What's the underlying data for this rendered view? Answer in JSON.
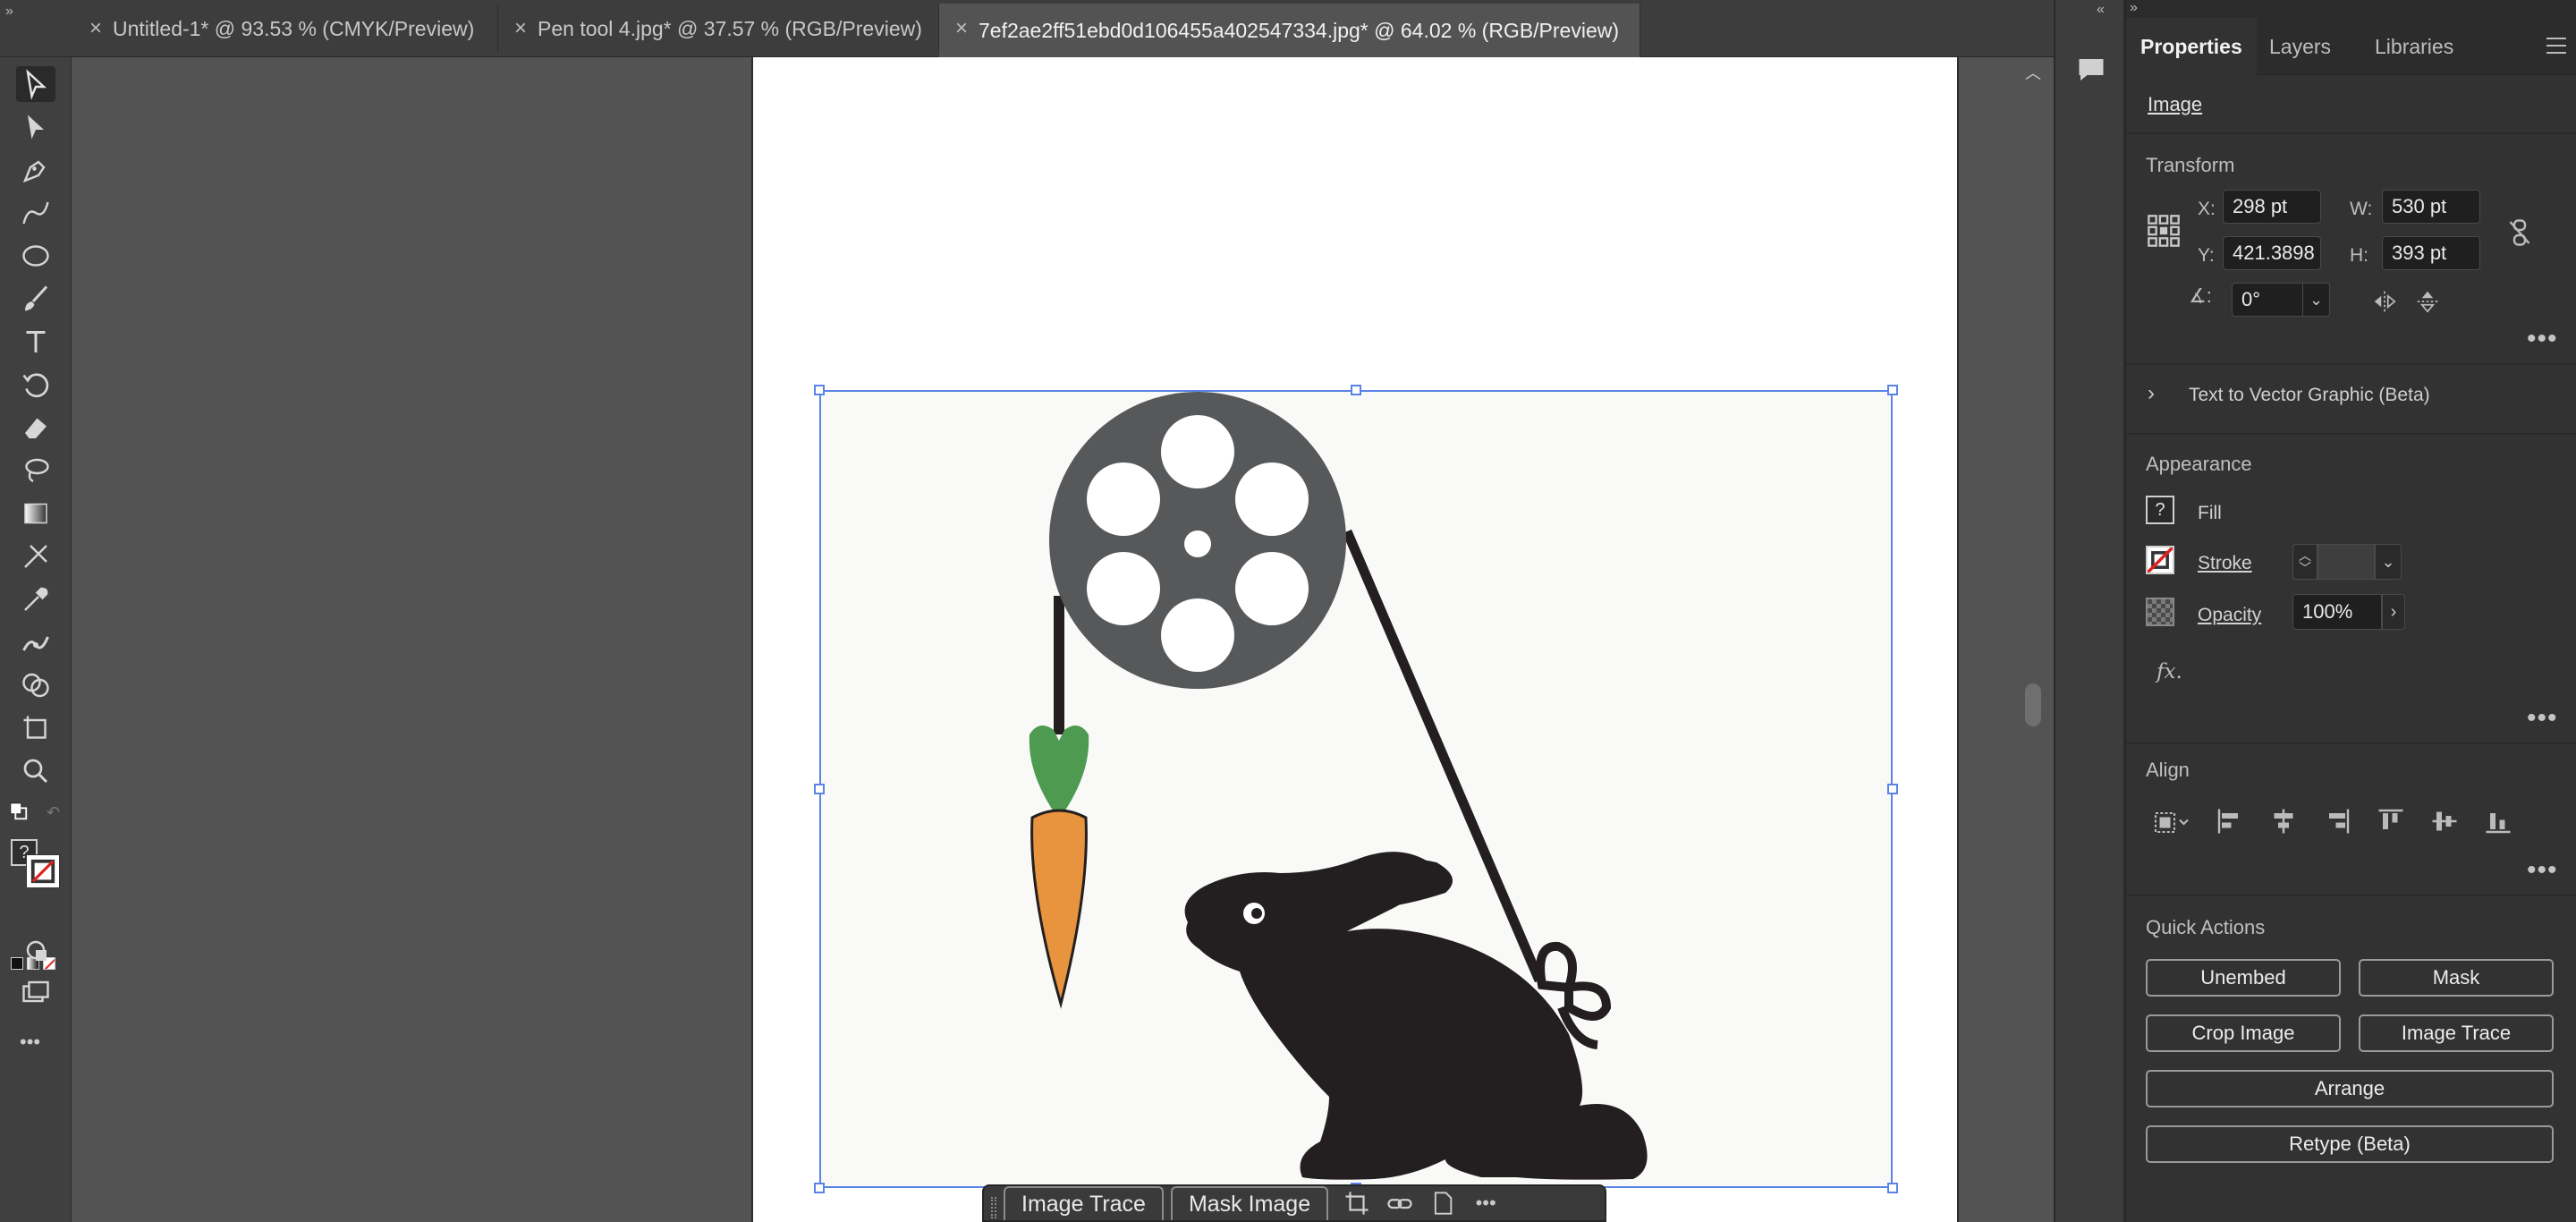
{
  "tabs": [
    {
      "label": "Untitled-1* @ 93.53 % (CMYK/Preview)",
      "close": "×"
    },
    {
      "label": "Pen tool 4.jpg* @ 37.57 % (RGB/Preview)",
      "close": "×"
    },
    {
      "label": "7ef2ae2ff51ebd0d106455a402547334.jpg* @ 64.02 % (RGB/Preview)",
      "close": "×"
    }
  ],
  "context_bar": {
    "image_trace": "Image Trace",
    "mask_image": "Mask Image",
    "more": "•••"
  },
  "panel": {
    "tabs": [
      "Properties",
      "Layers",
      "Libraries"
    ],
    "selection_type": "Image",
    "transform": {
      "title": "Transform",
      "x_label": "X:",
      "x_value": "298 pt",
      "y_label": "Y:",
      "y_value": "421.3898",
      "w_label": "W:",
      "w_value": "530 pt",
      "h_label": "H:",
      "h_value": "393 pt",
      "angle_value": "0°"
    },
    "text_to_vector": "Text to Vector Graphic (Beta)",
    "appearance": {
      "title": "Appearance",
      "fill_label": "Fill",
      "fill_swatch": "?",
      "stroke_label": "Stroke",
      "opacity_label": "Opacity",
      "opacity_value": "100%",
      "fx_label": "fx."
    },
    "align": {
      "title": "Align"
    },
    "quick_actions": {
      "title": "Quick Actions",
      "unembed": "Unembed",
      "mask": "Mask",
      "crop_image": "Crop Image",
      "image_trace": "Image Trace",
      "arrange": "Arrange",
      "retype": "Retype (Beta)"
    },
    "more": "•••"
  },
  "toolbar": {
    "fill_unknown": "?",
    "more": "•••"
  },
  "colors": {
    "accent_selection": "#5b83e6",
    "carrot_orange": "#e8933d",
    "carrot_green": "#4e9a51",
    "reel_gray": "#57585a",
    "rabbit_black": "#231f20"
  }
}
